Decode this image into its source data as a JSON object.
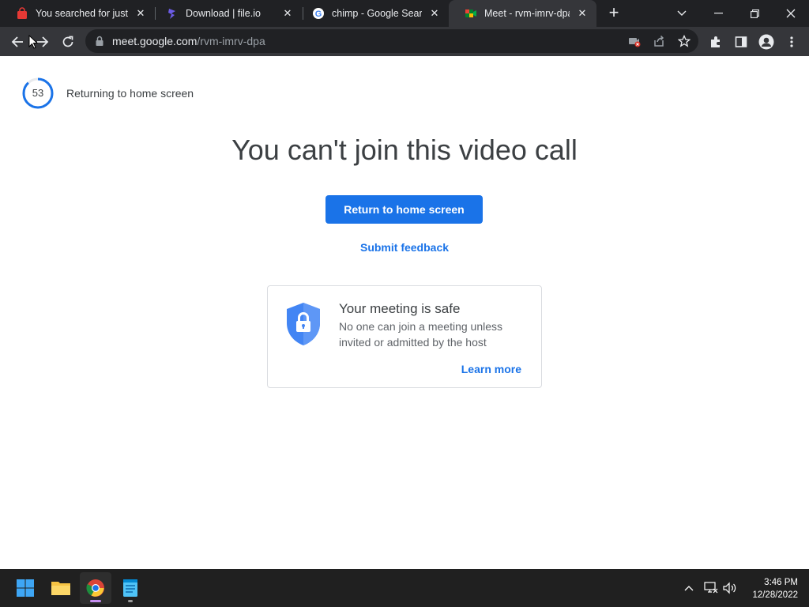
{
  "tabs": [
    {
      "title": "You searched for just sl",
      "favicon": "red-bag-icon",
      "active": false
    },
    {
      "title": "Download | file.io",
      "favicon": "fileio-icon",
      "active": false
    },
    {
      "title": "chimp - Google Search",
      "favicon": "google-icon",
      "active": false
    },
    {
      "title": "Meet - rvm-imrv-dpa",
      "favicon": "meet-icon",
      "active": true
    }
  ],
  "address_bar": {
    "domain": "meet.google.com",
    "path": "/rvm-imrv-dpa"
  },
  "page": {
    "countdown": "53",
    "countdown_fraction": 0.88,
    "returning_label": "Returning to home screen",
    "headline": "You can't join this video call",
    "return_button": "Return to home screen",
    "feedback_link": "Submit feedback",
    "safe_card": {
      "title": "Your meeting is safe",
      "description": "No one can join a meeting unless invited or admitted by the host",
      "learn_more": "Learn more"
    }
  },
  "taskbar": {
    "time": "3:46 PM",
    "date": "12/28/2022"
  },
  "colors": {
    "accent": "#1a73e8",
    "shield": "#4285f4",
    "text": "#3c4043"
  }
}
